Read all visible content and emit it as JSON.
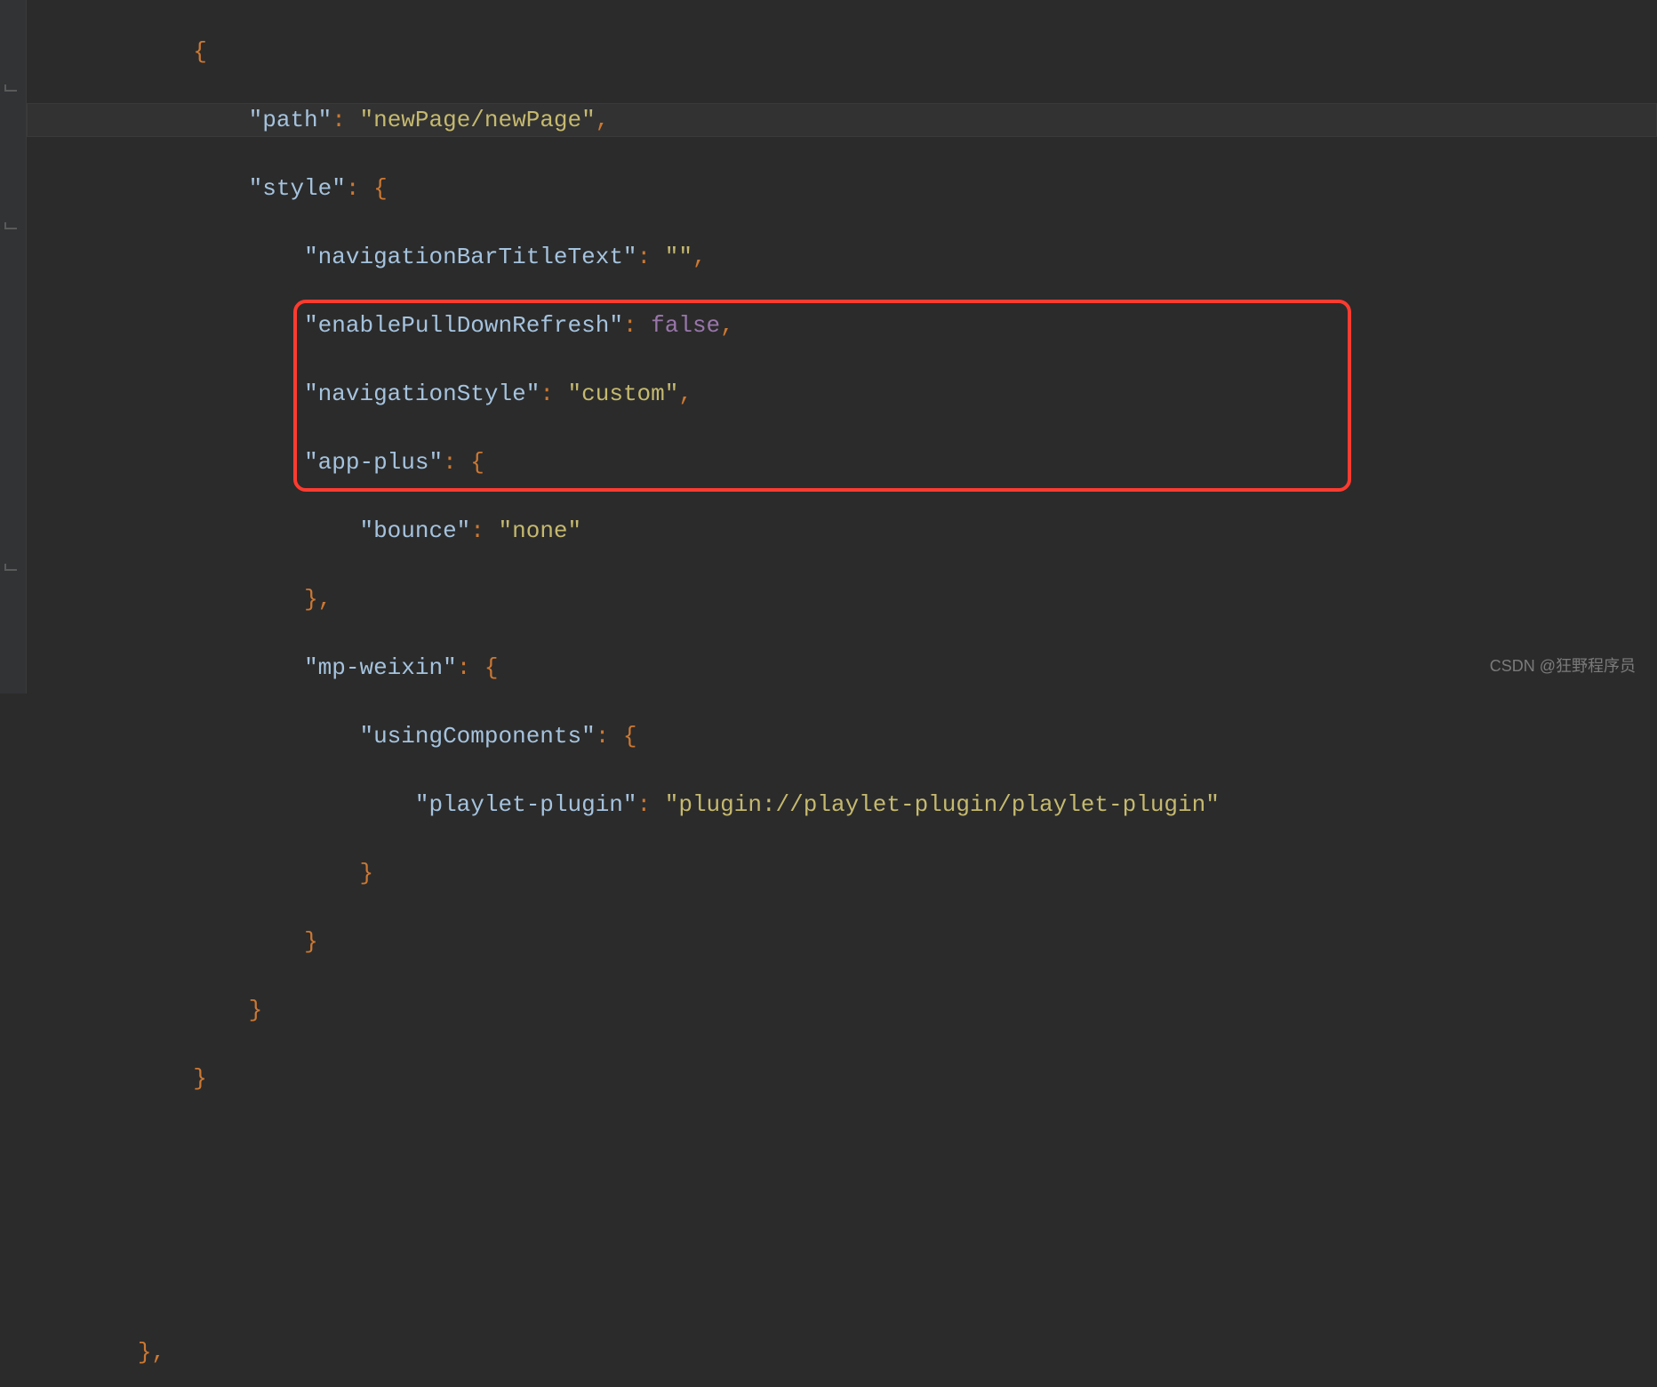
{
  "code": {
    "lineIndent": [
      "            ",
      "                ",
      "                ",
      "                    ",
      "                    ",
      "                    ",
      "                    ",
      "                        ",
      "                    ",
      "                    ",
      "                        ",
      "                            ",
      "                        ",
      "                    ",
      "                ",
      "            ",
      "",
      "",
      "",
      "        "
    ],
    "key_path": "\"path\"",
    "val_path": "\"newPage/newPage\"",
    "key_style": "\"style\"",
    "key_navTitle": "\"navigationBarTitleText\"",
    "val_navTitle": "\"\"",
    "key_pull": "\"enablePullDownRefresh\"",
    "val_pull": "false",
    "key_navStyle": "\"navigationStyle\"",
    "val_navStyle": "\"custom\"",
    "key_appPlus": "\"app-plus\"",
    "key_bounce": "\"bounce\"",
    "val_bounce": "\"none\"",
    "key_mpWeixin": "\"mp-weixin\"",
    "key_usingComponents": "\"usingComponents\"",
    "key_playlet": "\"playlet-plugin\"",
    "val_playlet": "\"plugin://playlet-plugin/playlet-plugin\"",
    "br_open": "{",
    "br_close": "}",
    "br_close_comma": "},",
    "colon": ": ",
    "colon_open": ": {",
    "comma": ","
  },
  "watermark": "CSDN @狂野程序员"
}
